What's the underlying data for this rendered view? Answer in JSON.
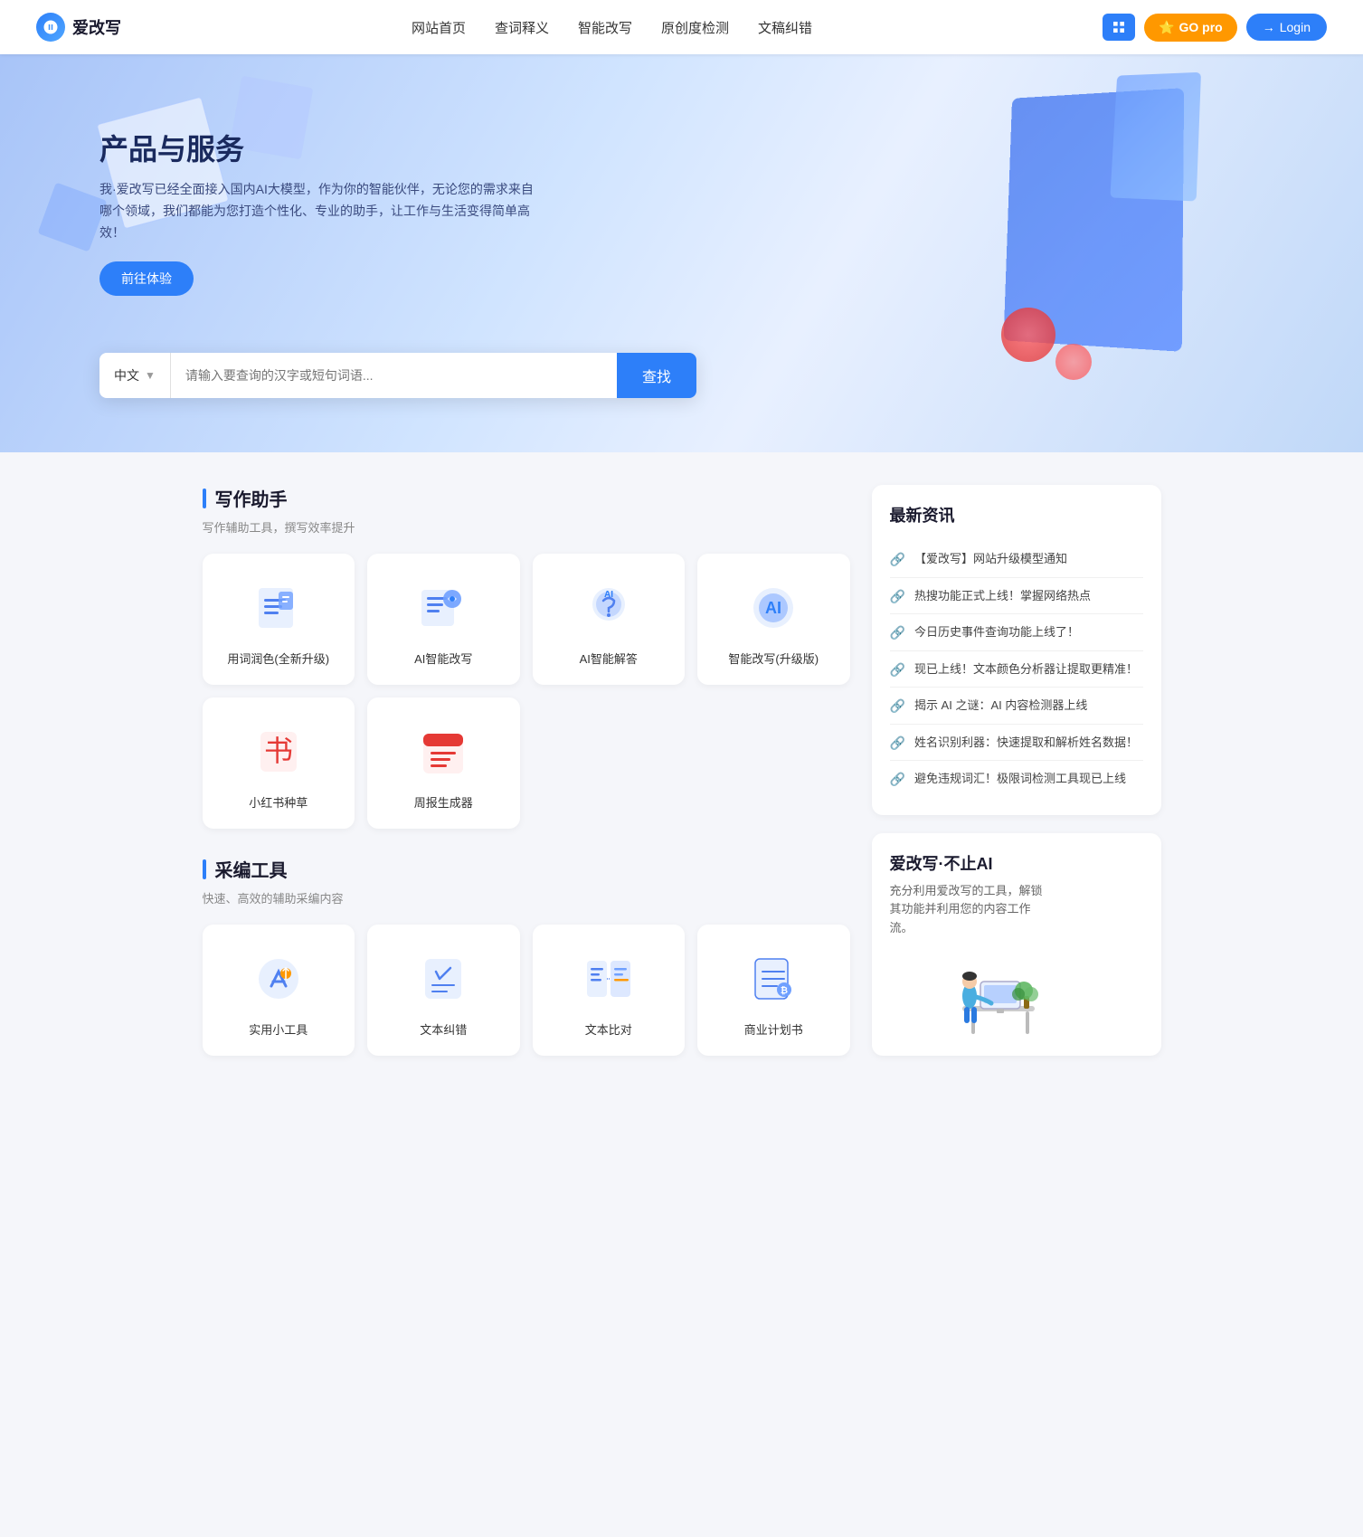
{
  "header": {
    "logo_text": "爱改写",
    "nav": [
      {
        "label": "网站首页",
        "id": "home"
      },
      {
        "label": "查词释义",
        "id": "dict"
      },
      {
        "label": "智能改写",
        "id": "rewrite"
      },
      {
        "label": "原创度检测",
        "id": "check"
      },
      {
        "label": "文稿纠错",
        "id": "correct"
      }
    ],
    "btn_grid_label": "grid",
    "btn_go_pro_label": "GO pro",
    "btn_login_label": "Login"
  },
  "hero": {
    "title": "产品与服务",
    "subtitle": "我·爱改写已经全面接入国内AI大模型，作为你的智能伙伴，无论您的需求来自哪个领域，我们都能为您打造个性化、专业的助手，让工作与生活变得简单高效！",
    "btn_try": "前往体验",
    "search": {
      "lang": "中文",
      "placeholder": "请输入要查询的汉字或短句词语...",
      "btn_label": "查找"
    }
  },
  "writing_section": {
    "title": "写作助手",
    "subtitle": "写作辅助工具，撰写效率提升",
    "cards": [
      {
        "label": "用词润色(全新升级)",
        "icon": "edit-icon"
      },
      {
        "label": "AI智能改写",
        "icon": "ai-rewrite-icon"
      },
      {
        "label": "AI智能解答",
        "icon": "ai-answer-icon"
      },
      {
        "label": "智能改写(升级版)",
        "icon": "ai-upgrade-icon"
      },
      {
        "label": "小红书种草",
        "icon": "xiaohongshu-icon"
      },
      {
        "label": "周报生成器",
        "icon": "weekly-icon"
      }
    ]
  },
  "tools_section": {
    "title": "采编工具",
    "subtitle": "快速、高效的辅助采编内容",
    "cards": [
      {
        "label": "实用小工具",
        "icon": "tools-icon"
      },
      {
        "label": "文本纠错",
        "icon": "correct-icon"
      },
      {
        "label": "文本比对",
        "icon": "compare-icon"
      },
      {
        "label": "商业计划书",
        "icon": "plan-icon"
      }
    ]
  },
  "news_section": {
    "title": "最新资讯",
    "items": [
      {
        "text": "【爱改写】网站升级模型通知"
      },
      {
        "text": "热搜功能正式上线！掌握网络热点"
      },
      {
        "text": "今日历史事件查询功能上线了！"
      },
      {
        "text": "现已上线！文本颜色分析器让提取更精准！"
      },
      {
        "text": "揭示 AI 之谜：AI 内容检测器上线"
      },
      {
        "text": "姓名识别利器：快速提取和解析姓名数据！"
      },
      {
        "text": "避免违规词汇！极限词检测工具现已上线"
      }
    ]
  },
  "promo": {
    "title": "爱改写·不止AI",
    "subtitle": "充分利用爱改写的工具，解锁其功能并利用您的内容工作流。"
  },
  "colors": {
    "primary": "#2d7ff9",
    "orange": "#ff9800",
    "red": "#e53935",
    "text_dark": "#1a1a2e",
    "text_muted": "#888888"
  }
}
